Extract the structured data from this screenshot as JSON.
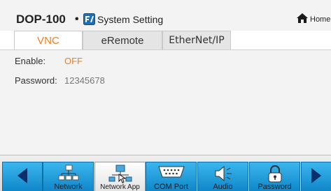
{
  "header": {
    "brand": "DOP-100",
    "separator": "•",
    "title": "System Setting",
    "home_label": "Home",
    "setting_icon": "system-setting-icon",
    "home_icon": "home-icon"
  },
  "tabs": [
    {
      "label": "VNC",
      "active": true
    },
    {
      "label": "eRemote",
      "active": false
    },
    {
      "label": "EtherNet/IP",
      "active": false
    }
  ],
  "vnc": {
    "enable_label": "Enable:",
    "enable_value": "OFF",
    "password_label": "Password:",
    "password_value": "12345678"
  },
  "nav": {
    "items": [
      {
        "label": "Network",
        "icon": "network-icon",
        "active": false
      },
      {
        "label": "Network App",
        "icon": "network-app-icon",
        "active": true
      },
      {
        "label": "COM Port",
        "icon": "com-port-icon",
        "active": false
      },
      {
        "label": "Audio",
        "icon": "speaker-icon",
        "active": false
      },
      {
        "label": "Password",
        "icon": "lock-icon",
        "active": false
      }
    ]
  },
  "colors": {
    "accent": "#f07d16",
    "nav_blue": "#1a9ad9",
    "background": "#f3f3f3"
  }
}
